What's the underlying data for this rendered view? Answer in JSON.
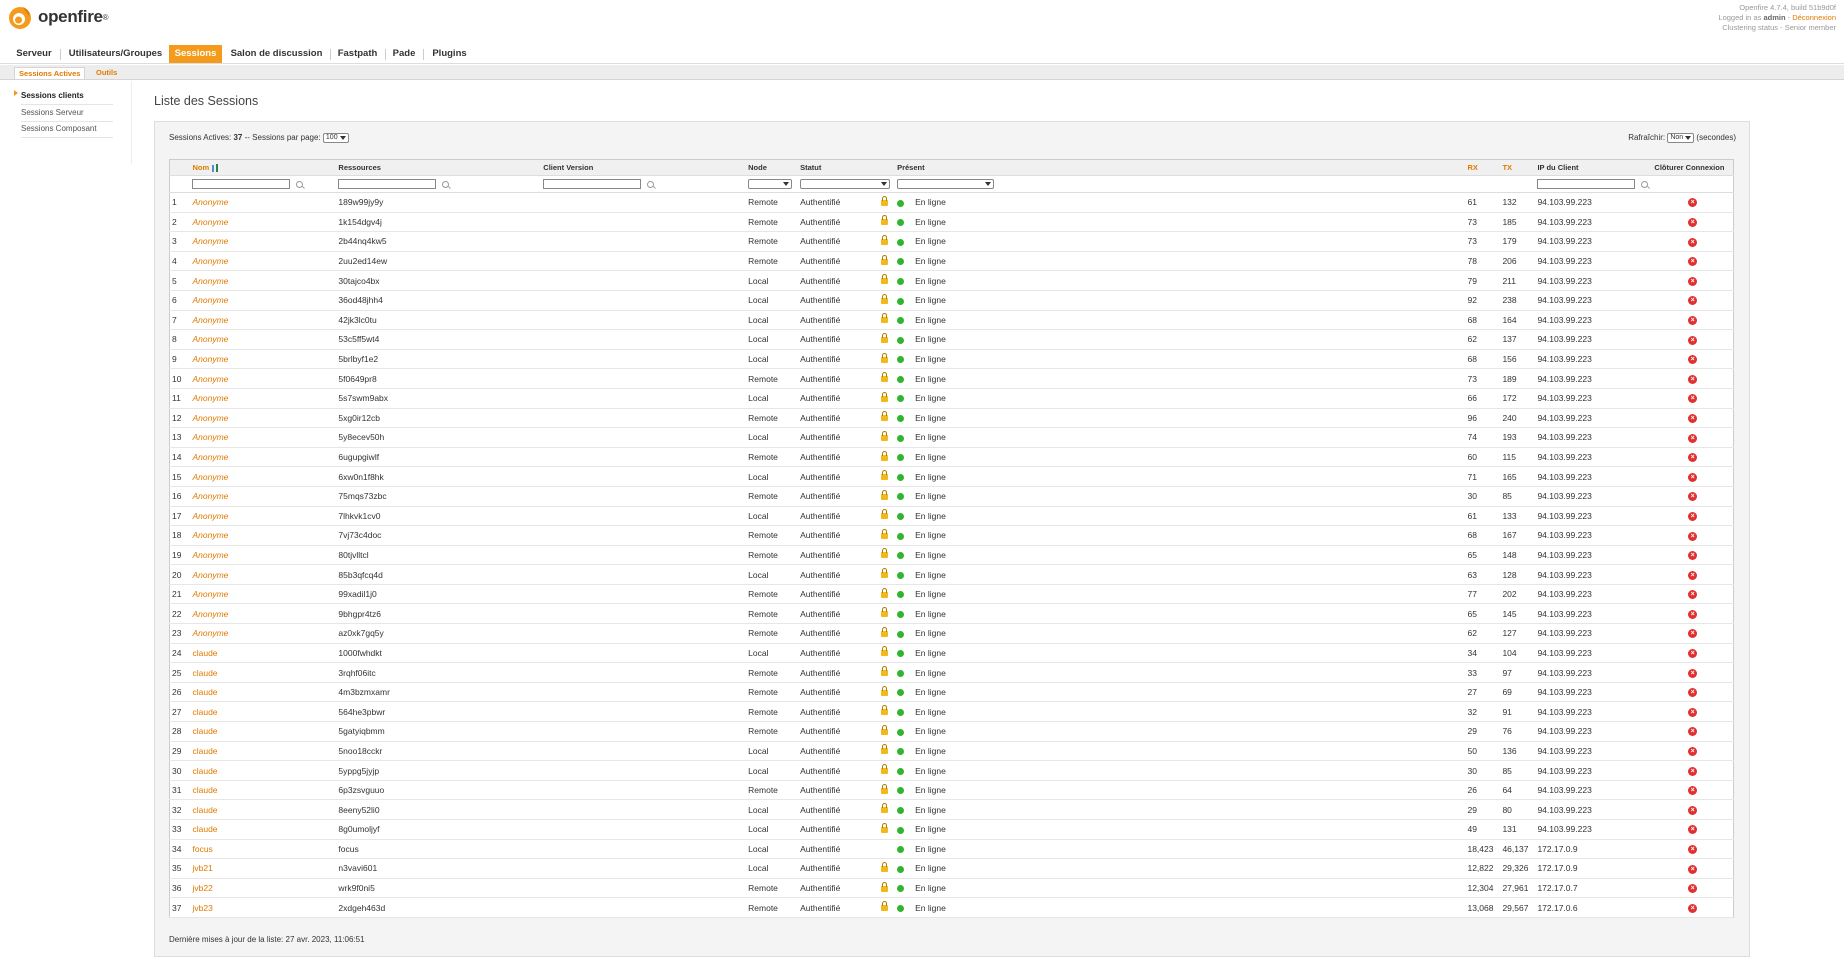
{
  "header": {
    "app_name": "openfire",
    "trademark": "®",
    "version_text": "Openfire 4.7.4, build 51b9d0f",
    "logged_in_prefix": "Logged in as",
    "user": "admin",
    "logout": "Déconnexion",
    "cluster_status": "Clustering status - Senior member"
  },
  "tabs": [
    "Serveur",
    "Utilisateurs/Groupes",
    "Sessions",
    "Salon de discussion",
    "Fastpath",
    "Pade",
    "Plugins"
  ],
  "subtabs": [
    "Sessions Actives",
    "Outils"
  ],
  "sidebar": [
    "Sessions clients",
    "Sessions Serveur",
    "Sessions Composant"
  ],
  "page_title": "Liste des Sessions",
  "controls": {
    "active_label": "Sessions Actives:",
    "active_count": "37",
    "per_page_label": "-- Sessions par page:",
    "per_page_value": "100",
    "refresh_label": "Rafraîchir:",
    "refresh_value": "Non",
    "refresh_unit": "(secondes)"
  },
  "columns": {
    "name": "Nom",
    "resource": "Ressources",
    "client_version": "Client Version",
    "node": "Node",
    "status": "Statut",
    "presence": "Présent",
    "rx": "RX",
    "tx": "TX",
    "ip": "IP du Client",
    "close": "Clôturer Connexion"
  },
  "rows": [
    {
      "n": "1",
      "name": "Anonyme",
      "res": "189w99jy9y",
      "node": "Remote",
      "status": "Authentifié",
      "lock": true,
      "presence": "En ligne",
      "rx": "61",
      "tx": "132",
      "ip": "94.103.99.223"
    },
    {
      "n": "2",
      "name": "Anonyme",
      "res": "1k154dgv4j",
      "node": "Remote",
      "status": "Authentifié",
      "lock": true,
      "presence": "En ligne",
      "rx": "73",
      "tx": "185",
      "ip": "94.103.99.223"
    },
    {
      "n": "3",
      "name": "Anonyme",
      "res": "2b44nq4kw5",
      "node": "Remote",
      "status": "Authentifié",
      "lock": true,
      "presence": "En ligne",
      "rx": "73",
      "tx": "179",
      "ip": "94.103.99.223"
    },
    {
      "n": "4",
      "name": "Anonyme",
      "res": "2uu2ed14ew",
      "node": "Remote",
      "status": "Authentifié",
      "lock": true,
      "presence": "En ligne",
      "rx": "78",
      "tx": "206",
      "ip": "94.103.99.223"
    },
    {
      "n": "5",
      "name": "Anonyme",
      "res": "30tajco4bx",
      "node": "Local",
      "status": "Authentifié",
      "lock": true,
      "presence": "En ligne",
      "rx": "79",
      "tx": "211",
      "ip": "94.103.99.223"
    },
    {
      "n": "6",
      "name": "Anonyme",
      "res": "36od48jhh4",
      "node": "Local",
      "status": "Authentifié",
      "lock": true,
      "presence": "En ligne",
      "rx": "92",
      "tx": "238",
      "ip": "94.103.99.223"
    },
    {
      "n": "7",
      "name": "Anonyme",
      "res": "42jk3lc0tu",
      "node": "Local",
      "status": "Authentifié",
      "lock": true,
      "presence": "En ligne",
      "rx": "68",
      "tx": "164",
      "ip": "94.103.99.223"
    },
    {
      "n": "8",
      "name": "Anonyme",
      "res": "53c5ff5wt4",
      "node": "Local",
      "status": "Authentifié",
      "lock": true,
      "presence": "En ligne",
      "rx": "62",
      "tx": "137",
      "ip": "94.103.99.223"
    },
    {
      "n": "9",
      "name": "Anonyme",
      "res": "5brlbyf1e2",
      "node": "Local",
      "status": "Authentifié",
      "lock": true,
      "presence": "En ligne",
      "rx": "68",
      "tx": "156",
      "ip": "94.103.99.223"
    },
    {
      "n": "10",
      "name": "Anonyme",
      "res": "5f0649pr8",
      "node": "Remote",
      "status": "Authentifié",
      "lock": true,
      "presence": "En ligne",
      "rx": "73",
      "tx": "189",
      "ip": "94.103.99.223"
    },
    {
      "n": "11",
      "name": "Anonyme",
      "res": "5s7swm9abx",
      "node": "Local",
      "status": "Authentifié",
      "lock": true,
      "presence": "En ligne",
      "rx": "66",
      "tx": "172",
      "ip": "94.103.99.223"
    },
    {
      "n": "12",
      "name": "Anonyme",
      "res": "5xg0ir12cb",
      "node": "Remote",
      "status": "Authentifié",
      "lock": true,
      "presence": "En ligne",
      "rx": "96",
      "tx": "240",
      "ip": "94.103.99.223"
    },
    {
      "n": "13",
      "name": "Anonyme",
      "res": "5y8ecev50h",
      "node": "Local",
      "status": "Authentifié",
      "lock": true,
      "presence": "En ligne",
      "rx": "74",
      "tx": "193",
      "ip": "94.103.99.223"
    },
    {
      "n": "14",
      "name": "Anonyme",
      "res": "6ugupgiwlf",
      "node": "Remote",
      "status": "Authentifié",
      "lock": true,
      "presence": "En ligne",
      "rx": "60",
      "tx": "115",
      "ip": "94.103.99.223"
    },
    {
      "n": "15",
      "name": "Anonyme",
      "res": "6xw0n1f8hk",
      "node": "Local",
      "status": "Authentifié",
      "lock": true,
      "presence": "En ligne",
      "rx": "71",
      "tx": "165",
      "ip": "94.103.99.223"
    },
    {
      "n": "16",
      "name": "Anonyme",
      "res": "75mqs73zbc",
      "node": "Remote",
      "status": "Authentifié",
      "lock": true,
      "presence": "En ligne",
      "rx": "30",
      "tx": "85",
      "ip": "94.103.99.223"
    },
    {
      "n": "17",
      "name": "Anonyme",
      "res": "7lhkvk1cv0",
      "node": "Local",
      "status": "Authentifié",
      "lock": true,
      "presence": "En ligne",
      "rx": "61",
      "tx": "133",
      "ip": "94.103.99.223"
    },
    {
      "n": "18",
      "name": "Anonyme",
      "res": "7vj73c4doc",
      "node": "Remote",
      "status": "Authentifié",
      "lock": true,
      "presence": "En ligne",
      "rx": "68",
      "tx": "167",
      "ip": "94.103.99.223"
    },
    {
      "n": "19",
      "name": "Anonyme",
      "res": "80tjvlltcl",
      "node": "Remote",
      "status": "Authentifié",
      "lock": true,
      "presence": "En ligne",
      "rx": "65",
      "tx": "148",
      "ip": "94.103.99.223"
    },
    {
      "n": "20",
      "name": "Anonyme",
      "res": "85b3qfcq4d",
      "node": "Local",
      "status": "Authentifié",
      "lock": true,
      "presence": "En ligne",
      "rx": "63",
      "tx": "128",
      "ip": "94.103.99.223"
    },
    {
      "n": "21",
      "name": "Anonyme",
      "res": "99xadil1j0",
      "node": "Remote",
      "status": "Authentifié",
      "lock": true,
      "presence": "En ligne",
      "rx": "77",
      "tx": "202",
      "ip": "94.103.99.223"
    },
    {
      "n": "22",
      "name": "Anonyme",
      "res": "9bhgpr4tz6",
      "node": "Remote",
      "status": "Authentifié",
      "lock": true,
      "presence": "En ligne",
      "rx": "65",
      "tx": "145",
      "ip": "94.103.99.223"
    },
    {
      "n": "23",
      "name": "Anonyme",
      "res": "az0xk7gq5y",
      "node": "Remote",
      "status": "Authentifié",
      "lock": true,
      "presence": "En ligne",
      "rx": "62",
      "tx": "127",
      "ip": "94.103.99.223"
    },
    {
      "n": "24",
      "name": "claude",
      "res": "1000fwhdkt",
      "node": "Local",
      "status": "Authentifié",
      "lock": true,
      "presence": "En ligne",
      "rx": "34",
      "tx": "104",
      "ip": "94.103.99.223"
    },
    {
      "n": "25",
      "name": "claude",
      "res": "3rqhf06itc",
      "node": "Remote",
      "status": "Authentifié",
      "lock": true,
      "presence": "En ligne",
      "rx": "33",
      "tx": "97",
      "ip": "94.103.99.223"
    },
    {
      "n": "26",
      "name": "claude",
      "res": "4m3bzmxamr",
      "node": "Remote",
      "status": "Authentifié",
      "lock": true,
      "presence": "En ligne",
      "rx": "27",
      "tx": "69",
      "ip": "94.103.99.223"
    },
    {
      "n": "27",
      "name": "claude",
      "res": "564he3pbwr",
      "node": "Remote",
      "status": "Authentifié",
      "lock": true,
      "presence": "En ligne",
      "rx": "32",
      "tx": "91",
      "ip": "94.103.99.223"
    },
    {
      "n": "28",
      "name": "claude",
      "res": "5gatyiqbmm",
      "node": "Remote",
      "status": "Authentifié",
      "lock": true,
      "presence": "En ligne",
      "rx": "29",
      "tx": "76",
      "ip": "94.103.99.223"
    },
    {
      "n": "29",
      "name": "claude",
      "res": "5noo18cckr",
      "node": "Local",
      "status": "Authentifié",
      "lock": true,
      "presence": "En ligne",
      "rx": "50",
      "tx": "136",
      "ip": "94.103.99.223"
    },
    {
      "n": "30",
      "name": "claude",
      "res": "5yppg5jyjp",
      "node": "Local",
      "status": "Authentifié",
      "lock": true,
      "presence": "En ligne",
      "rx": "30",
      "tx": "85",
      "ip": "94.103.99.223"
    },
    {
      "n": "31",
      "name": "claude",
      "res": "6p3zsvguuo",
      "node": "Remote",
      "status": "Authentifié",
      "lock": true,
      "presence": "En ligne",
      "rx": "26",
      "tx": "64",
      "ip": "94.103.99.223"
    },
    {
      "n": "32",
      "name": "claude",
      "res": "8eeny52li0",
      "node": "Local",
      "status": "Authentifié",
      "lock": true,
      "presence": "En ligne",
      "rx": "29",
      "tx": "80",
      "ip": "94.103.99.223"
    },
    {
      "n": "33",
      "name": "claude",
      "res": "8g0umoljyf",
      "node": "Local",
      "status": "Authentifié",
      "lock": true,
      "presence": "En ligne",
      "rx": "49",
      "tx": "131",
      "ip": "94.103.99.223"
    },
    {
      "n": "34",
      "name": "focus",
      "res": "focus",
      "node": "Local",
      "status": "Authentifié",
      "lock": false,
      "presence": "En ligne",
      "rx": "18,423",
      "tx": "46,137",
      "ip": "172.17.0.9"
    },
    {
      "n": "35",
      "name": "jvb21",
      "res": "n3vavi601",
      "node": "Local",
      "status": "Authentifié",
      "lock": true,
      "presence": "En ligne",
      "rx": "12,822",
      "tx": "29,326",
      "ip": "172.17.0.9"
    },
    {
      "n": "36",
      "name": "jvb22",
      "res": "wrk9f0ni5",
      "node": "Remote",
      "status": "Authentifié",
      "lock": true,
      "presence": "En ligne",
      "rx": "12,304",
      "tx": "27,961",
      "ip": "172.17.0.7"
    },
    {
      "n": "37",
      "name": "jvb23",
      "res": "2xdgeh463d",
      "node": "Remote",
      "status": "Authentifié",
      "lock": true,
      "presence": "En ligne",
      "rx": "13,068",
      "tx": "29,567",
      "ip": "172.17.0.6"
    }
  ],
  "footer_note": "Dernière mises à jour de la liste: 27 avr. 2023, 11:06:51",
  "colors": {
    "accent": "#f59b1c",
    "link": "#e07a00",
    "online": "#2fb52f",
    "close": "#e23030"
  },
  "icons": {
    "logo": "openfire-flame-icon",
    "lock": "lock-icon",
    "presence": "online-dot-icon",
    "close": "close-icon",
    "search": "search-icon",
    "sort": "sort-icon"
  }
}
